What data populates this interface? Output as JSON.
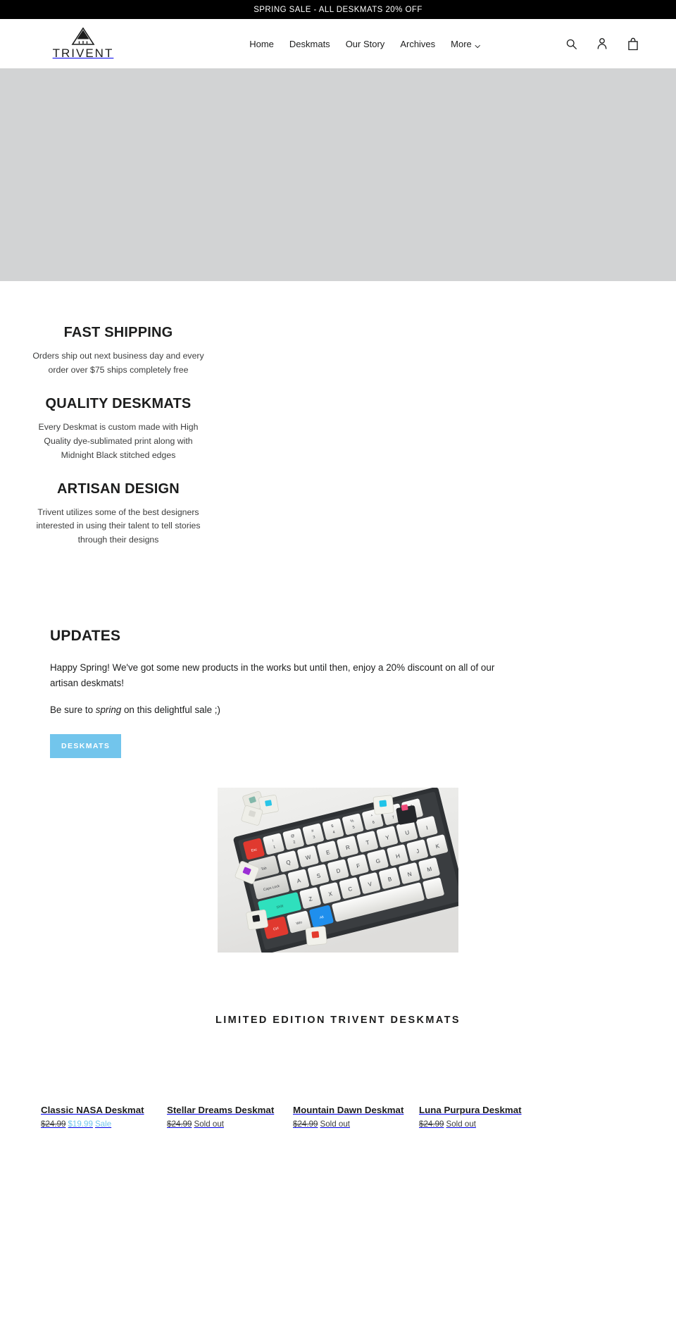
{
  "announcement": {
    "text": "SPRING SALE - ALL DESKMATS 20% OFF"
  },
  "header": {
    "logo_word": "TRIVENT",
    "logo_icon": "mountain-peak-logo",
    "nav": [
      {
        "label": "Home"
      },
      {
        "label": "Deskmats"
      },
      {
        "label": "Our Story"
      },
      {
        "label": "Archives"
      },
      {
        "label": "More",
        "has_chevron": true
      }
    ],
    "icons": [
      {
        "name": "search-icon"
      },
      {
        "name": "account-icon"
      },
      {
        "name": "cart-icon"
      }
    ]
  },
  "hero": {
    "background_color": "#d2d3d4"
  },
  "features": [
    {
      "title": "FAST SHIPPING",
      "body": "Orders ship out next business day and every order over $75 ships completely free"
    },
    {
      "title": "QUALITY DESKMATS",
      "body": "Every Deskmat is custom made with High Quality dye-sublimated print along with Midnight Black stitched edges"
    },
    {
      "title": "ARTISAN DESIGN",
      "body": "Trivent utilizes some of the best designers interested in using their talent to tell stories through their designs"
    }
  ],
  "updates": {
    "title": "UPDATES",
    "paragraph_1": "Happy Spring! We've got some new products in the works but until then, enjoy a 20% discount on all of our artisan deskmats!",
    "paragraph_2_before": "Be sure to ",
    "paragraph_2_em": "spring",
    "paragraph_2_after": " on this delightful sale ;)",
    "button_label": "DESKMATS",
    "button_color": "#72c5ec"
  },
  "photo": {
    "alt": "mechanical keyboard with loose switches on white desk"
  },
  "collection": {
    "title": "LIMITED EDITION TRIVENT DESKMATS",
    "products": [
      {
        "name": "Classic NASA Deskmat",
        "price_old": "$24.99",
        "price_sale": "$19.99",
        "status": "Sale",
        "on_sale": true
      },
      {
        "name": "Stellar Dreams Deskmat",
        "price_old": "$24.99",
        "price_sale": "",
        "status": "Sold out",
        "on_sale": false
      },
      {
        "name": "Mountain Dawn Deskmat",
        "price_old": "$24.99",
        "price_sale": "",
        "status": "Sold out",
        "on_sale": false
      },
      {
        "name": "Luna Purpura Deskmat",
        "price_old": "$24.99",
        "price_sale": "",
        "status": "Sold out",
        "on_sale": false
      }
    ]
  }
}
